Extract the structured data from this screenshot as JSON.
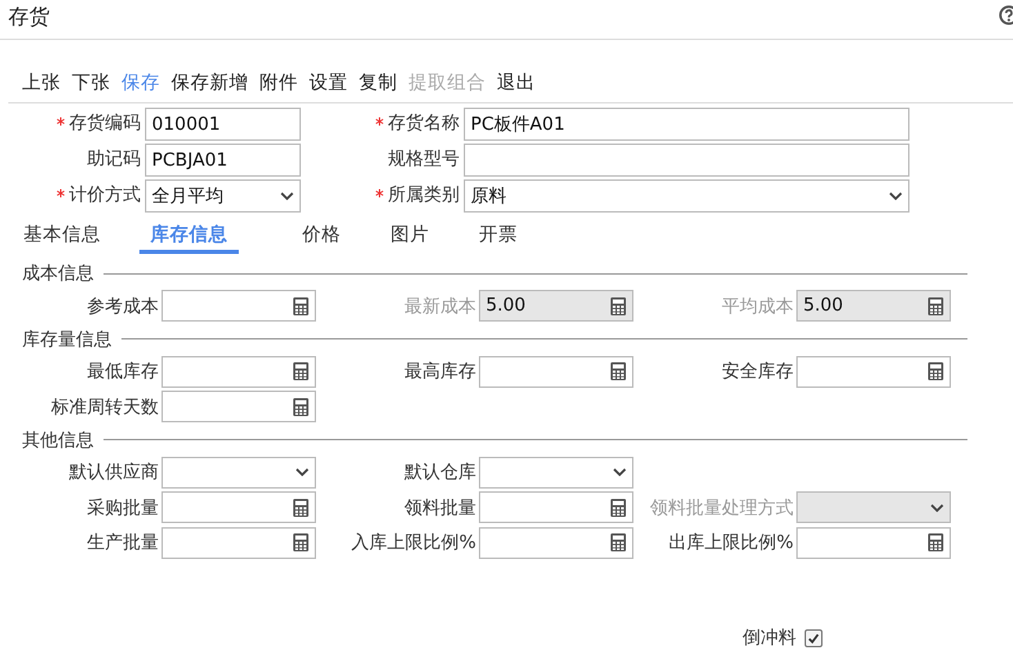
{
  "window": {
    "title": "存货"
  },
  "toolbar": [
    {
      "label": "上张",
      "highlighted": false,
      "disabled": false
    },
    {
      "label": "下张",
      "highlighted": false,
      "disabled": false
    },
    {
      "label": "保存",
      "highlighted": true,
      "disabled": false
    },
    {
      "label": "保存新增",
      "highlighted": false,
      "disabled": false
    },
    {
      "label": "附件",
      "highlighted": false,
      "disabled": false
    },
    {
      "label": "设置",
      "highlighted": false,
      "disabled": false
    },
    {
      "label": "复制",
      "highlighted": false,
      "disabled": false
    },
    {
      "label": "提取组合",
      "highlighted": false,
      "disabled": true
    },
    {
      "label": "退出",
      "highlighted": false,
      "disabled": false
    }
  ],
  "header_fields": [
    {
      "label": "存货编码",
      "required": true,
      "kind": "text",
      "value": "010001"
    },
    {
      "label": "存货名称",
      "required": true,
      "kind": "text",
      "value": "PC板件A01"
    },
    {
      "label": "助记码",
      "required": false,
      "kind": "text",
      "value": "PCBJA01"
    },
    {
      "label": "规格型号",
      "required": false,
      "kind": "text"
    },
    {
      "label": "计价方式",
      "required": true,
      "kind": "select",
      "value": "全月平均"
    },
    {
      "label": "所属类别",
      "required": true,
      "kind": "select",
      "value": "原料"
    }
  ],
  "tabs": [
    {
      "label": "基本信息",
      "selected": false
    },
    {
      "label": "库存信息",
      "selected": true
    },
    {
      "label": "价格",
      "selected": false
    },
    {
      "label": "图片",
      "selected": false
    },
    {
      "label": "开票",
      "selected": false
    }
  ],
  "sections": [
    {
      "title": "成本信息",
      "rows": [
        [
          {
            "label": "参考成本",
            "kind": "number",
            "disabled": false
          },
          {
            "label": "最新成本",
            "kind": "number",
            "disabled": true,
            "value": "5.00"
          },
          {
            "label": "平均成本",
            "kind": "number",
            "disabled": true,
            "value": "5.00"
          }
        ]
      ]
    },
    {
      "title": "库存量信息",
      "rows": [
        [
          {
            "label": "最低库存",
            "kind": "number",
            "disabled": false
          },
          {
            "label": "最高库存",
            "kind": "number",
            "disabled": false
          },
          {
            "label": "安全库存",
            "kind": "number",
            "disabled": false
          }
        ],
        [
          {
            "label": "标准周转天数",
            "kind": "number",
            "disabled": false
          }
        ]
      ]
    },
    {
      "title": "其他信息",
      "rows": [
        [
          {
            "label": "默认供应商",
            "kind": "select",
            "disabled": false
          },
          {
            "label": "默认仓库",
            "kind": "select",
            "disabled": false
          }
        ],
        [
          {
            "label": "采购批量",
            "kind": "number",
            "disabled": false
          },
          {
            "label": "领料批量",
            "kind": "number",
            "disabled": false
          },
          {
            "label": "领料批量处理方式",
            "kind": "select",
            "disabled": true
          }
        ],
        [
          {
            "label": "生产批量",
            "kind": "number",
            "disabled": false
          },
          {
            "label": "入库上限比例%",
            "kind": "number",
            "disabled": false
          },
          {
            "label": "出库上限比例%",
            "kind": "number",
            "disabled": false
          }
        ]
      ]
    }
  ],
  "backflush": {
    "label": "倒冲料",
    "checked": true
  }
}
